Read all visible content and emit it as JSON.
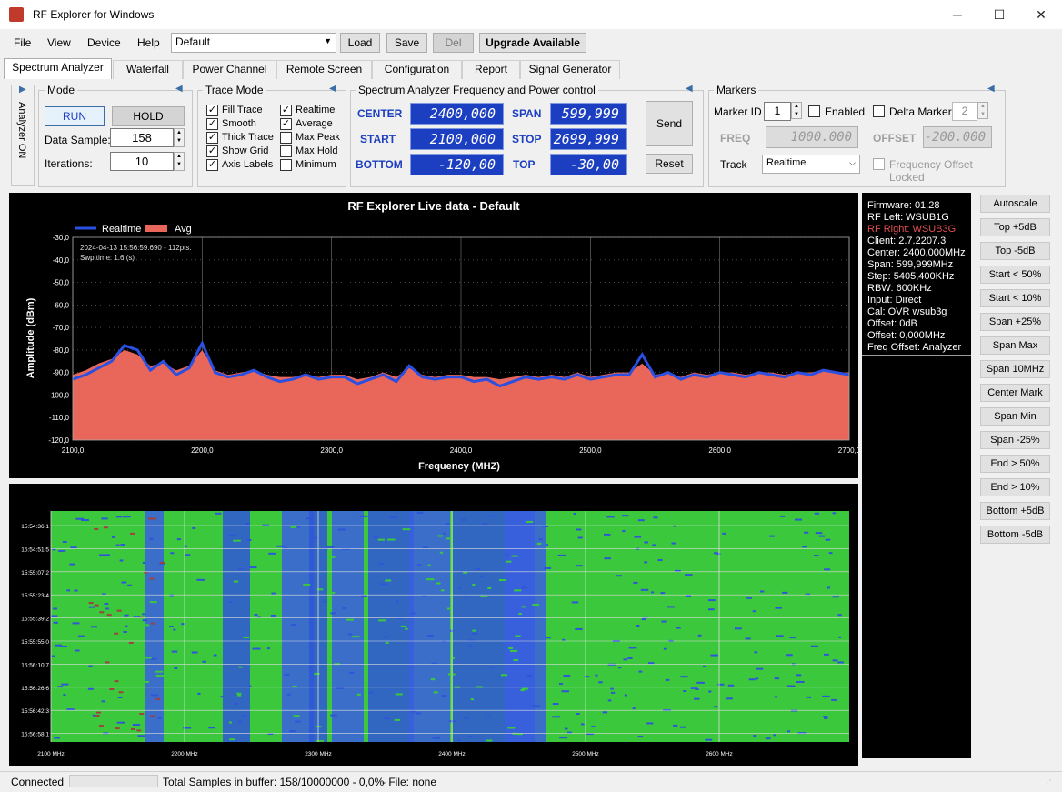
{
  "window": {
    "title": "RF Explorer for Windows",
    "minimize": "─",
    "maximize": "☐",
    "close": "✕"
  },
  "menu": {
    "file": "File",
    "view": "View",
    "device": "Device",
    "help": "Help"
  },
  "toolbar": {
    "preset_value": "Default",
    "load": "Load",
    "save": "Save",
    "del": "Del",
    "upgrade": "Upgrade Available"
  },
  "tabs": [
    "Spectrum Analyzer",
    "Waterfall",
    "Power Channel",
    "Remote Screen",
    "Configuration",
    "Report",
    "Signal Generator"
  ],
  "analyzer_side": "Analyzer ON",
  "mode": {
    "title": "Mode",
    "run": "RUN",
    "hold": "HOLD",
    "data_sample_label": "Data Sample:",
    "data_sample": "158",
    "iterations_label": "Iterations:",
    "iterations": "10"
  },
  "trace_mode": {
    "title": "Trace Mode",
    "left": [
      {
        "label": "Fill Trace",
        "checked": true
      },
      {
        "label": "Smooth",
        "checked": true
      },
      {
        "label": "Thick Trace",
        "checked": true
      },
      {
        "label": "Show Grid",
        "checked": true
      },
      {
        "label": "Axis Labels",
        "checked": true
      }
    ],
    "right": [
      {
        "label": "Realtime",
        "checked": true
      },
      {
        "label": "Average",
        "checked": true
      },
      {
        "label": "Max Peak",
        "checked": false
      },
      {
        "label": "Max Hold",
        "checked": false
      },
      {
        "label": "Minimum",
        "checked": false
      }
    ]
  },
  "freq_control": {
    "title": "Spectrum Analyzer Frequency and Power control",
    "center_label": "CENTER",
    "center": "2400,000",
    "start_label": "START",
    "start": "2100,000",
    "bottom_label": "BOTTOM",
    "bottom": "-120,00",
    "span_label": "SPAN",
    "span": "599,999",
    "stop_label": "STOP",
    "stop": "2699,999",
    "top_label": "TOP",
    "top": "-30,00",
    "send": "Send",
    "reset": "Reset"
  },
  "markers": {
    "title": "Markers",
    "marker_id_label": "Marker ID",
    "marker_id": "1",
    "enabled": "Enabled",
    "delta_marker": "Delta Marker",
    "delta_id": "2",
    "freq_label": "FREQ",
    "freq": "1000.000",
    "offset_label": "OFFSET",
    "offset": "-200.000",
    "track_label": "Track",
    "track_value": "Realtime",
    "freq_offset_locked": "Frequency Offset Locked"
  },
  "chart_data": {
    "type": "area",
    "title": "RF Explorer Live data - Default",
    "xlabel": "Frequency (MHZ)",
    "ylabel": "Amplitude (dBm)",
    "xlim": [
      2100,
      2700
    ],
    "ylim": [
      -120,
      -30
    ],
    "x_ticks": [
      "2100,0",
      "2200,0",
      "2300,0",
      "2400,0",
      "2500,0",
      "2600,0",
      "2700,0"
    ],
    "y_ticks": [
      "-30,0",
      "-40,0",
      "-50,0",
      "-60,0",
      "-70,0",
      "-80,0",
      "-90,0",
      "-100,0",
      "-110,0",
      "-120,0"
    ],
    "legend": [
      "Realtime",
      "Avg"
    ],
    "legend_position": "top-left",
    "colors": {
      "realtime": "#2b4fe0",
      "avg": "#e8665a"
    },
    "annotation_line1": "2024-04-13  15:56:59.690  -  112pts.",
    "annotation_line2": "Swp time: 1.6 (s)",
    "x": [
      2100,
      2110,
      2120,
      2130,
      2140,
      2150,
      2160,
      2170,
      2180,
      2190,
      2200,
      2210,
      2220,
      2230,
      2240,
      2250,
      2260,
      2270,
      2280,
      2290,
      2300,
      2310,
      2320,
      2330,
      2340,
      2350,
      2360,
      2370,
      2380,
      2390,
      2400,
      2410,
      2420,
      2430,
      2440,
      2450,
      2460,
      2470,
      2480,
      2490,
      2500,
      2510,
      2520,
      2530,
      2540,
      2550,
      2560,
      2570,
      2580,
      2590,
      2600,
      2610,
      2620,
      2630,
      2640,
      2650,
      2660,
      2670,
      2680,
      2690,
      2700
    ],
    "series": [
      {
        "name": "Realtime",
        "values": [
          -93,
          -91,
          -88,
          -85,
          -78,
          -80,
          -89,
          -85,
          -91,
          -88,
          -77,
          -90,
          -92,
          -91,
          -89,
          -92,
          -94,
          -93,
          -91,
          -93,
          -92,
          -92,
          -95,
          -93,
          -91,
          -94,
          -87,
          -92,
          -93,
          -92,
          -92,
          -94,
          -93,
          -96,
          -94,
          -92,
          -93,
          -92,
          -93,
          -91,
          -93,
          -92,
          -91,
          -91,
          -82,
          -92,
          -90,
          -93,
          -91,
          -92,
          -90,
          -91,
          -92,
          -90,
          -91,
          -92,
          -90,
          -91,
          -89,
          -90,
          -91
        ]
      },
      {
        "name": "Avg",
        "values": [
          -91,
          -89,
          -86,
          -84,
          -80,
          -82,
          -87,
          -86,
          -89,
          -87,
          -80,
          -89,
          -91,
          -90,
          -89,
          -91,
          -92,
          -92,
          -91,
          -92,
          -91,
          -91,
          -93,
          -92,
          -90,
          -92,
          -88,
          -91,
          -92,
          -91,
          -91,
          -92,
          -92,
          -93,
          -92,
          -91,
          -92,
          -91,
          -92,
          -90,
          -92,
          -91,
          -90,
          -90,
          -86,
          -91,
          -90,
          -92,
          -90,
          -91,
          -90,
          -90,
          -91,
          -90,
          -90,
          -91,
          -90,
          -90,
          -89,
          -90,
          -90
        ]
      }
    ]
  },
  "waterfall": {
    "times": [
      "15:54:36.1",
      "15:54:51.5",
      "15:55:07.2",
      "15:55:23.4",
      "15:55:39.2",
      "15:55:55.0",
      "15:56:10.7",
      "15:56:26.6",
      "15:56:42.3",
      "15:56:58.1"
    ],
    "freqs": [
      "2100 MHz",
      "2200 MHz",
      "2300 MHz",
      "2400 MHz",
      "2500 MHz",
      "2600 MHz"
    ]
  },
  "info": {
    "firmware": "Firmware: 01.28",
    "rf_left": "RF Left: WSUB1G",
    "rf_right": "RF Right: WSUB3G",
    "client": "Client: 2.7.2207.3",
    "center": "Center: 2400,000MHz",
    "span": "Span: 599,999MHz",
    "step": "Step: 5405,400KHz",
    "rbw": "RBW: 600KHz",
    "input": "Input: Direct",
    "cal": "Cal: OVR wsub3g",
    "offset_db": "Offset: 0dB",
    "offset_mhz": "Offset: 0,000MHz",
    "freq_offset": "Freq Offset: Analyzer",
    "rf_right_color": "#e05050"
  },
  "side_buttons": [
    "Autoscale",
    "Top +5dB",
    "Top -5dB",
    "Start < 50%",
    "Start < 10%",
    "Span +25%",
    "Span Max",
    "Span 10MHz",
    "Center Mark",
    "Span Min",
    "Span -25%",
    "End > 50%",
    "End > 10%",
    "Bottom +5dB",
    "Bottom -5dB"
  ],
  "status": {
    "connected": "Connected",
    "samples": "Total Samples in buffer: 158/10000000 - 0,0%",
    "file": "- File: none"
  }
}
